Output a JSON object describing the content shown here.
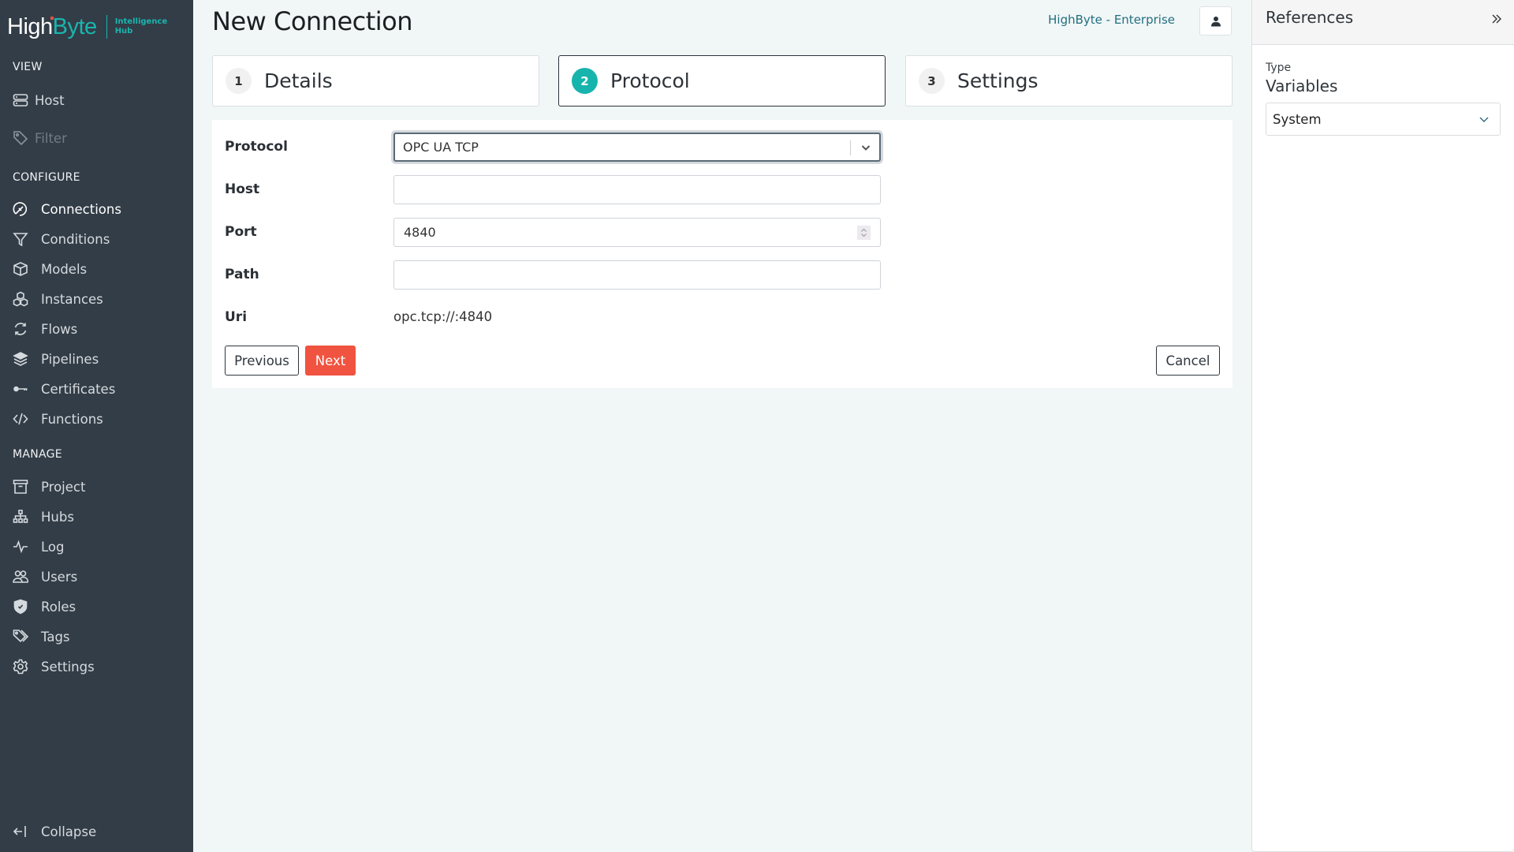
{
  "sidebar": {
    "logo": {
      "high": "High",
      "byte": "Byte",
      "sub_line1": "Intelligence",
      "sub_line2": "Hub"
    },
    "sections": {
      "view": "VIEW",
      "configure": "CONFIGURE",
      "manage": "MANAGE"
    },
    "view_items": [
      {
        "label": "Host",
        "icon": "server-icon"
      },
      {
        "label": "Filter",
        "icon": "tag-icon",
        "disabled": true
      }
    ],
    "configure_items": [
      {
        "label": "Connections",
        "icon": "plug-icon",
        "active": true
      },
      {
        "label": "Conditions",
        "icon": "funnel-icon"
      },
      {
        "label": "Models",
        "icon": "box-icon"
      },
      {
        "label": "Instances",
        "icon": "boxes-icon"
      },
      {
        "label": "Flows",
        "icon": "refresh-icon"
      },
      {
        "label": "Pipelines",
        "icon": "layers-icon"
      },
      {
        "label": "Certificates",
        "icon": "key-icon"
      },
      {
        "label": "Functions",
        "icon": "code-icon"
      }
    ],
    "manage_items": [
      {
        "label": "Project",
        "icon": "archive-icon"
      },
      {
        "label": "Hubs",
        "icon": "network-icon"
      },
      {
        "label": "Log",
        "icon": "activity-icon"
      },
      {
        "label": "Users",
        "icon": "users-icon"
      },
      {
        "label": "Roles",
        "icon": "shield-icon"
      },
      {
        "label": "Tags",
        "icon": "tags-icon"
      },
      {
        "label": "Settings",
        "icon": "gear-icon"
      }
    ],
    "collapse_label": "Collapse"
  },
  "header": {
    "title": "New Connection",
    "edition": "HighByte - Enterprise",
    "user_icon": "user-icon"
  },
  "steps": [
    {
      "number": "1",
      "label": "Details",
      "active": false
    },
    {
      "number": "2",
      "label": "Protocol",
      "active": true
    },
    {
      "number": "3",
      "label": "Settings",
      "active": false
    }
  ],
  "form": {
    "protocol": {
      "label": "Protocol",
      "value": "OPC UA TCP"
    },
    "host": {
      "label": "Host",
      "value": ""
    },
    "port": {
      "label": "Port",
      "value": "4840"
    },
    "path": {
      "label": "Path",
      "value": ""
    },
    "uri": {
      "label": "Uri",
      "value": "opc.tcp://:4840"
    },
    "buttons": {
      "previous": "Previous",
      "next": "Next",
      "cancel": "Cancel"
    }
  },
  "references": {
    "title": "References",
    "type_label": "Type",
    "type_value": "Variables",
    "select_value": "System"
  },
  "colors": {
    "sidebar_bg": "#333d47",
    "accent_teal": "#17b4ad",
    "primary_button": "#f05340",
    "page_bg": "#f1f6f7"
  }
}
